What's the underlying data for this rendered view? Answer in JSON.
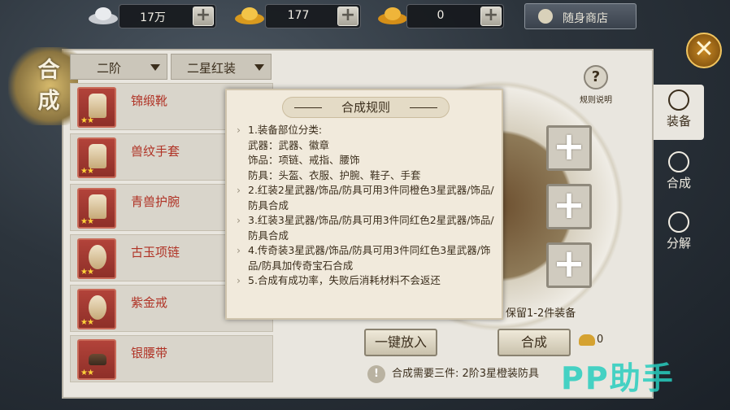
{
  "currency": [
    {
      "icon": "silver-ingot-icon",
      "value": "17万"
    },
    {
      "icon": "gold-ingot-icon",
      "value": "177"
    },
    {
      "icon": "bound-gold-ingot-icon",
      "value": "0"
    }
  ],
  "shop_button": "随身商店",
  "title": [
    "合",
    "成"
  ],
  "filters": {
    "tier": "二阶",
    "quality": "二星红装"
  },
  "items": [
    {
      "name": "锦缎靴",
      "stars": "★★"
    },
    {
      "name": "兽纹手套",
      "stars": "★★"
    },
    {
      "name": "青兽护腕",
      "stars": "★★"
    },
    {
      "name": "古玉项链",
      "stars": "★★"
    },
    {
      "name": "紫金戒",
      "stars": "★★"
    },
    {
      "name": "银腰带",
      "stars": "★★"
    }
  ],
  "tabs": [
    {
      "label": "装备"
    },
    {
      "label": "合成"
    },
    {
      "label": "分解"
    }
  ],
  "rule_link": "规则说明",
  "keep_text": "保留1-2件装备",
  "buttons": {
    "one_click": "一键放入",
    "synthesize": "合成"
  },
  "cost": "0",
  "requirement": "合成需要三件: 2阶3星橙装防具",
  "watermark": "PP助手",
  "modal": {
    "title": "合成规则",
    "rule1": "1.装备部位分类:",
    "rule1_lines": [
      "武器：武器、徽章",
      "饰品：项链、戒指、腰饰",
      "防具：头盔、衣服、护腕、鞋子、手套"
    ],
    "rule2": "2.红装2星武器/饰品/防具可用3件同橙色3星武器/饰品/防具合成",
    "rule3": "3.红装3星武器/饰品/防具可用3件同红色2星武器/饰品/防具合成",
    "rule4": "4.传奇装3星武器/饰品/防具可用3件同红色3星武器/饰品/防具加传奇宝石合成",
    "rule5": "5.合成有成功率，失败后消耗材料不会返还"
  },
  "colors": {
    "item_name": "#b03326",
    "panel": "#e9e6df",
    "watermark": "#28cdbe"
  }
}
